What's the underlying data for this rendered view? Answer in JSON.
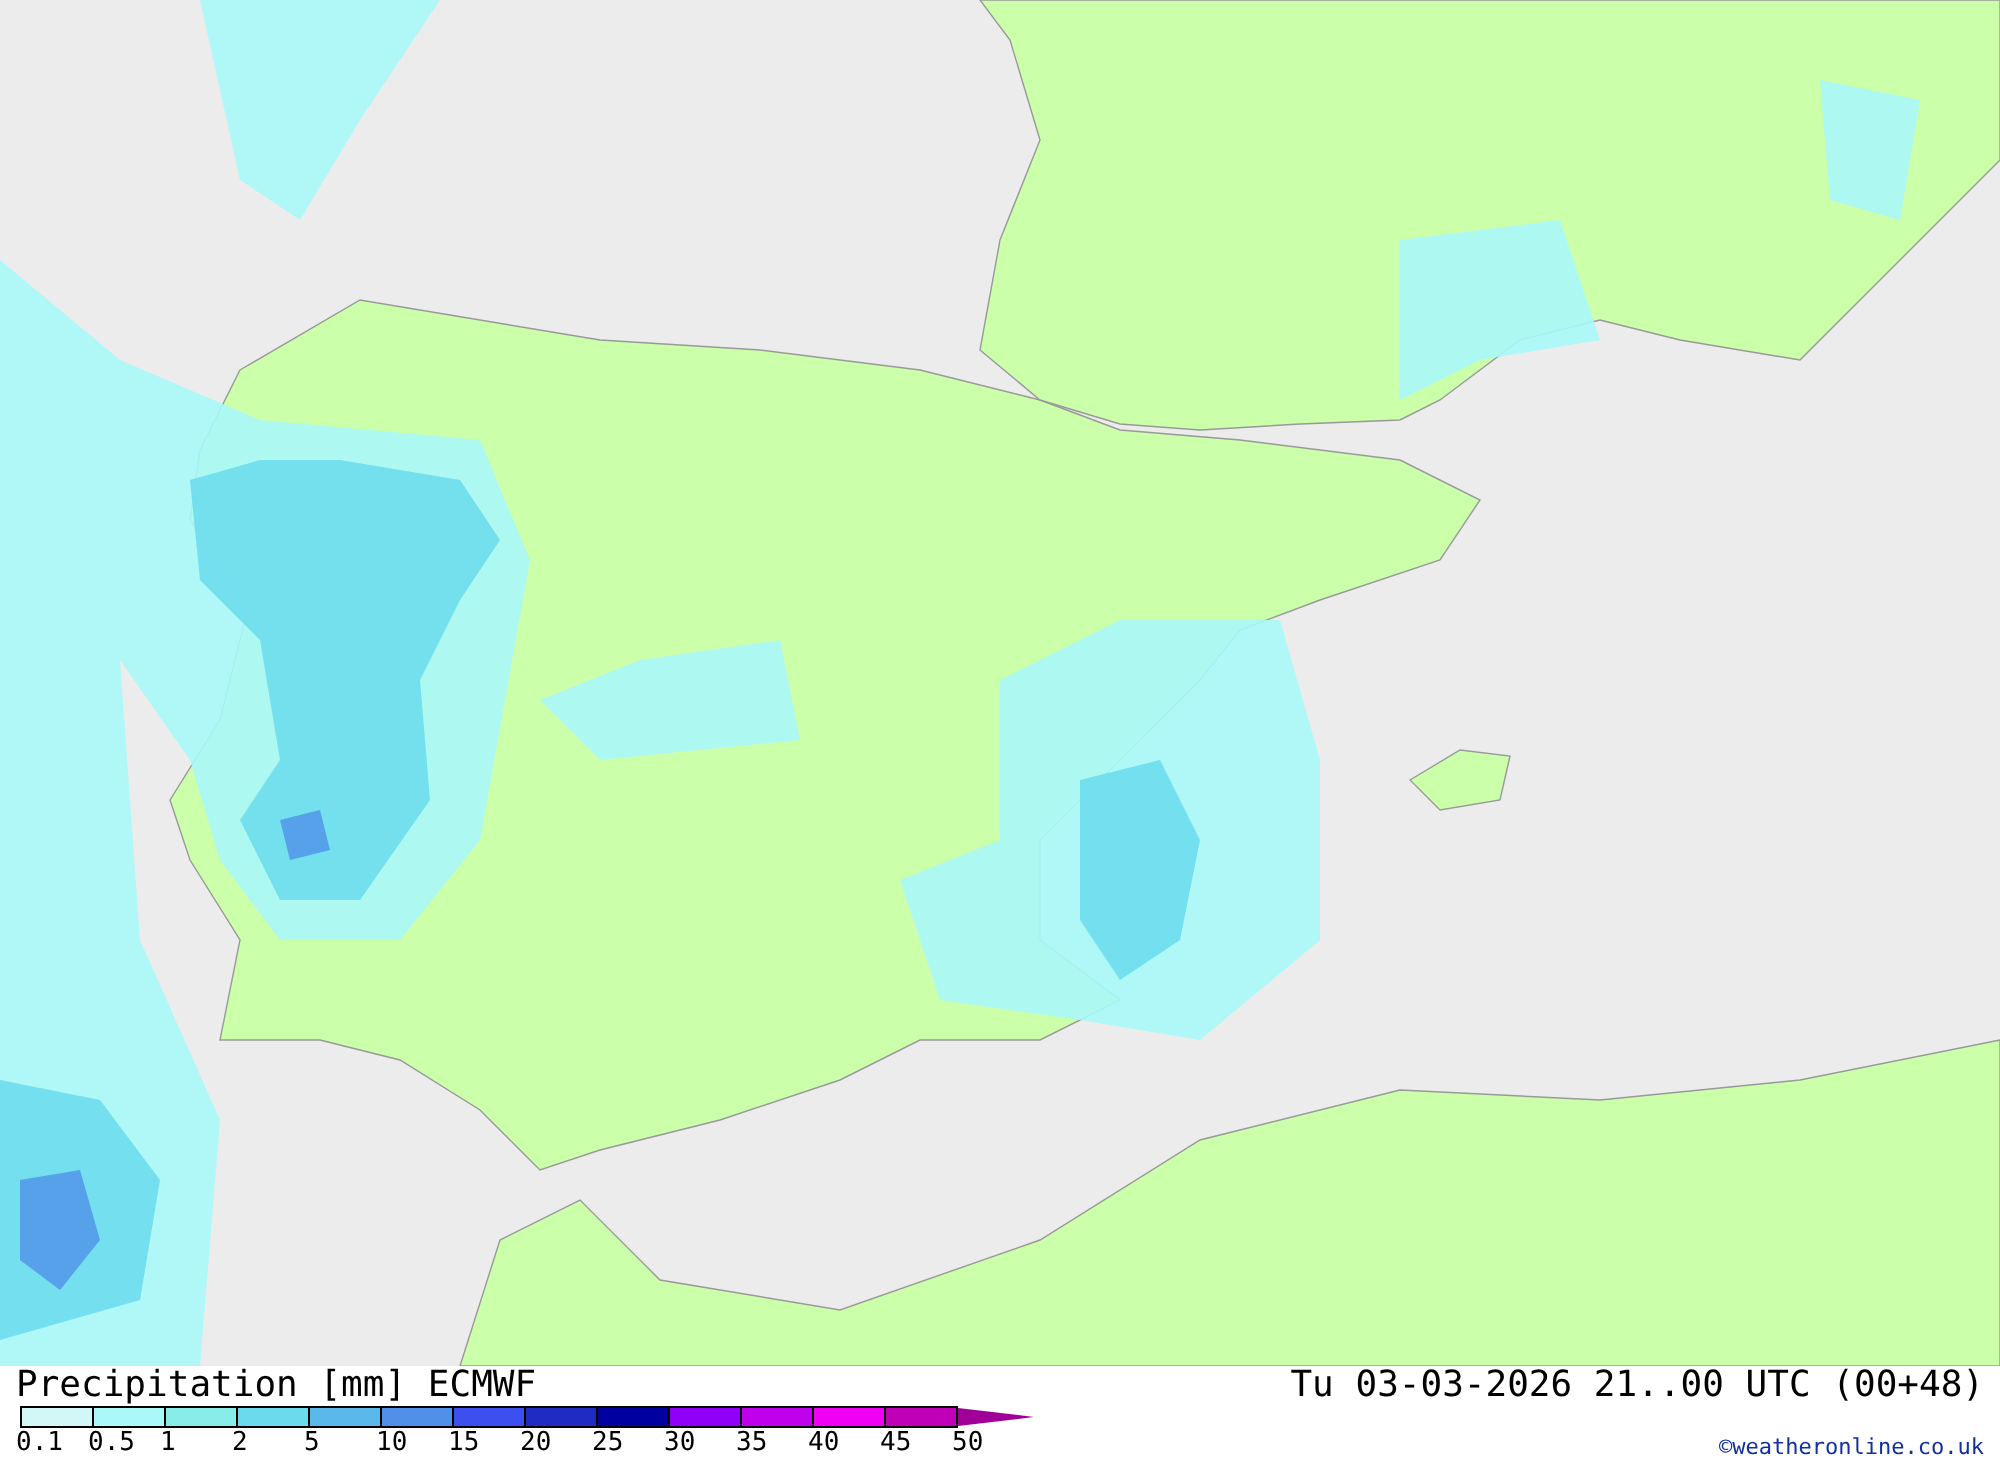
{
  "map": {
    "title": "Precipitation [mm] ECMWF",
    "valid_time": "Tu 03-03-2026 21..00 UTC (00+48)",
    "credit": "©weatheronline.co.uk"
  },
  "legend": [
    {
      "label": "0.1",
      "color": "#d2f7f7"
    },
    {
      "label": "0.5",
      "color": "#aaf8f8"
    },
    {
      "label": "1",
      "color": "#88ece8"
    },
    {
      "label": "2",
      "color": "#6adaec"
    },
    {
      "label": "5",
      "color": "#5ab8ea"
    },
    {
      "label": "10",
      "color": "#5090e8"
    },
    {
      "label": "15",
      "color": "#3c50f0"
    },
    {
      "label": "20",
      "color": "#1e2cc4"
    },
    {
      "label": "25",
      "color": "#0000a0"
    },
    {
      "label": "30",
      "color": "#9000f8"
    },
    {
      "label": "35",
      "color": "#c000ec"
    },
    {
      "label": "40",
      "color": "#f000f4"
    },
    {
      "label": "45",
      "color": "#c000b8"
    },
    {
      "label": "50",
      "color": "#a00098"
    }
  ]
}
